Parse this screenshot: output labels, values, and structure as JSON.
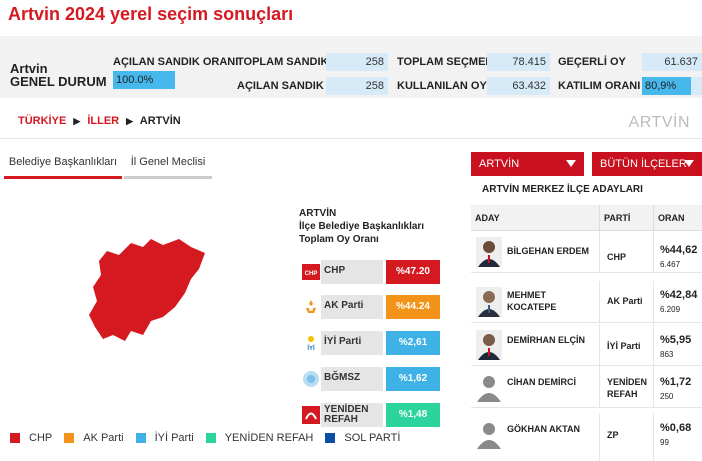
{
  "page": {
    "title": "Artvin 2024 yerel seçim sonuçları"
  },
  "summary": {
    "region_line1": "Artvin",
    "region_line2": "GENEL DURUM",
    "acilan_sandik_orani_label": "AÇILAN SANDIK ORANI",
    "acilan_sandik_orani_value": "100.0%",
    "acilan_sandik_orani_fraction": 1.0,
    "toplam_sandik_label": "TOPLAM SANDIK",
    "toplam_sandik_value": "258",
    "acilan_sandik_label": "AÇILAN SANDIK",
    "acilan_sandik_value": "258",
    "toplam_secmen_label": "TOPLAM SEÇMEN",
    "toplam_secmen_value": "78.415",
    "kullanilan_oy_label": "KULLANILAN OY",
    "kullanilan_oy_value": "63.432",
    "gecerli_oy_label": "GEÇERLİ OY",
    "gecerli_oy_value": "61.637",
    "katilim_orani_label": "KATILIM ORANI",
    "katilim_orani_value": "80,9%",
    "katilim_orani_fraction": 0.809
  },
  "breadcrumb": {
    "item1": "TÜRKİYE",
    "item2": "İLLER",
    "item3": "ARTVİN"
  },
  "region_watermark": "ARTVİN",
  "tabs": {
    "active": "Belediye Başkanlıkları",
    "inactive": "İl Genel Meclisi"
  },
  "panel": {
    "line1": "ARTVİN",
    "line2": "İlçe Belediye Başkanlıkları",
    "line3": "Toplam Oy Oranı"
  },
  "parties": [
    {
      "name_line1": "CHP",
      "name_line2": "",
      "pct": "%47.20",
      "color": "#d51920",
      "logo_icon": "chp-logo-icon"
    },
    {
      "name_line1": "AK Parti",
      "name_line2": "",
      "pct": "%44.24",
      "color": "#f39319",
      "logo_icon": "ak-parti-logo-icon"
    },
    {
      "name_line1": "İYİ Parti",
      "name_line2": "",
      "pct": "%2,61",
      "color": "#3eb2e6",
      "logo_icon": "iyi-parti-logo-icon"
    },
    {
      "name_line1": "BĞMSZ",
      "name_line2": "",
      "pct": "%1,62",
      "color": "#3eb2e6",
      "logo_icon": "bagimsiz-logo-icon"
    },
    {
      "name_line1": "YENİDEN",
      "name_line2": "REFAH",
      "pct": "%1,48",
      "color": "#2bd39d",
      "logo_icon": "yeniden-refah-logo-icon"
    }
  ],
  "legend": [
    {
      "label": "CHP",
      "color": "#d51920"
    },
    {
      "label": "AK Parti",
      "color": "#f39319"
    },
    {
      "label": "İYİ Parti",
      "color": "#3eb2e6"
    },
    {
      "label": "YENİDEN REFAH",
      "color": "#2bd39d"
    },
    {
      "label": "SOL PARTİ",
      "color": "#0a4fa3"
    }
  ],
  "dropdowns": {
    "city": "ARTVİN",
    "districts": "BÜTÜN İLÇELER"
  },
  "candidates": {
    "title": "ARTVİN MERKEZ İLÇE ADAYLARI",
    "headers": {
      "name": "ADAY",
      "party": "PARTİ",
      "pct": "ORAN"
    },
    "rows": [
      {
        "name_line1": "BİLGEHAN ERDEM",
        "name_line2": "",
        "party_line1": "CHP",
        "party_line2": "",
        "pct": "%44,62",
        "votes": "6.467"
      },
      {
        "name_line1": "MEHMET",
        "name_line2": "KOCATEPE",
        "party_line1": "AK Parti",
        "party_line2": "",
        "pct": "%42,84",
        "votes": "6.209"
      },
      {
        "name_line1": "DEMİRHAN ELÇİN",
        "name_line2": "",
        "party_line1": "İYİ Parti",
        "party_line2": "",
        "pct": "%5,95",
        "votes": "863"
      },
      {
        "name_line1": "CİHAN DEMİRCİ",
        "name_line2": "",
        "party_line1": "YENİDEN",
        "party_line2": "REFAH",
        "pct": "%1,72",
        "votes": "250"
      },
      {
        "name_line1": "GÖKHAN AKTAN",
        "name_line2": "",
        "party_line1": "ZP",
        "party_line2": "",
        "pct": "%0,68",
        "votes": "99"
      }
    ]
  }
}
